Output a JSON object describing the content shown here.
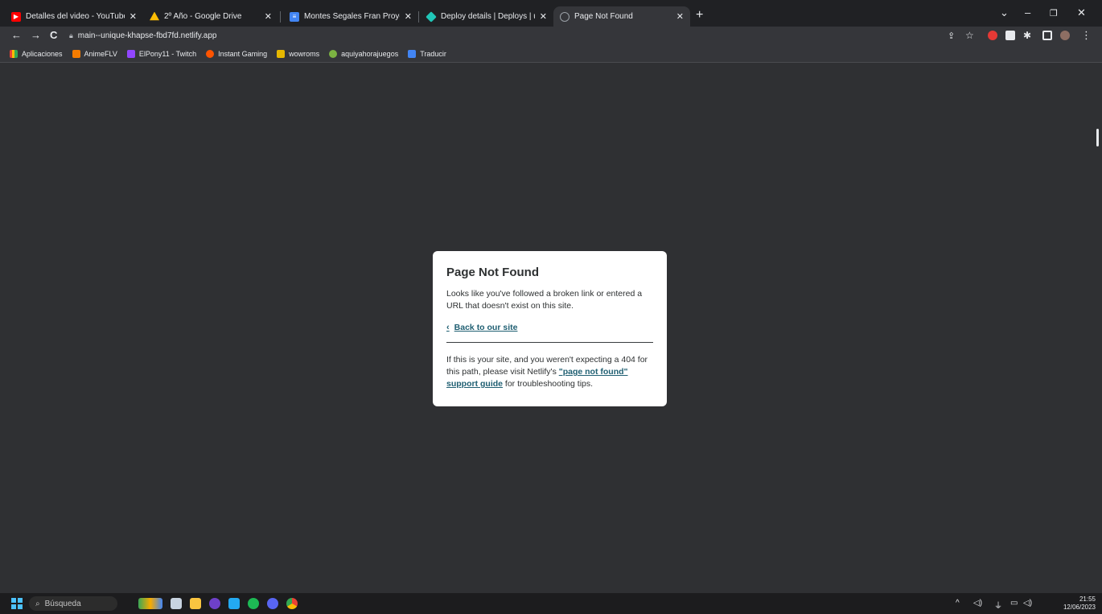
{
  "tabs": [
    {
      "title": "Detalles del video - YouTube Stu",
      "icon": "youtube-icon",
      "color": "#ff0000",
      "active": false
    },
    {
      "title": "2º Año - Google Drive",
      "icon": "google-drive-icon",
      "color": "#fbbc04",
      "active": false
    },
    {
      "title": "Montes Segales Fran ProyectoF",
      "icon": "google-docs-icon",
      "color": "#4285f4",
      "active": false
    },
    {
      "title": "Deploy details | Deploys | unique",
      "icon": "netlify-icon",
      "color": "#20c6b7",
      "active": false
    },
    {
      "title": "Page Not Found",
      "icon": "globe-icon",
      "color": "#9aa0a6",
      "active": true
    }
  ],
  "toolbar": {
    "url": "main--unique-khapse-fbd7fd.netlify.app"
  },
  "bookmarks": [
    {
      "label": "Aplicaciones",
      "icon": "apps-grid-icon",
      "color": "#f4b400"
    },
    {
      "label": "AnimeFLV",
      "icon": "animeflv-icon",
      "color": "#f57c00"
    },
    {
      "label": "ElPony11 - Twitch",
      "icon": "twitch-icon",
      "color": "#9146ff"
    },
    {
      "label": "Instant Gaming",
      "icon": "instant-gaming-icon",
      "color": "#ff5400"
    },
    {
      "label": "wowroms",
      "icon": "wowroms-icon",
      "color": "#e6b800"
    },
    {
      "label": "aquiyahorajuegos",
      "icon": "aquiyahorajuegos-icon",
      "color": "#7cb342"
    },
    {
      "label": "Traducir",
      "icon": "google-translate-icon",
      "color": "#4285f4"
    }
  ],
  "card": {
    "title": "Page Not Found",
    "description": "Looks like you've followed a broken link or entered a URL that doesn't exist on this site.",
    "back_link": "Back to our site",
    "footer_prefix": "If this is your site, and you weren't expecting a 404 for this path, please visit Netlify's ",
    "footer_link": "\"page not found\" support guide",
    "footer_suffix": " for troubleshooting tips."
  },
  "taskbar": {
    "search_placeholder": "Búsqueda",
    "time": "21:55",
    "date": "12/06/2023"
  }
}
